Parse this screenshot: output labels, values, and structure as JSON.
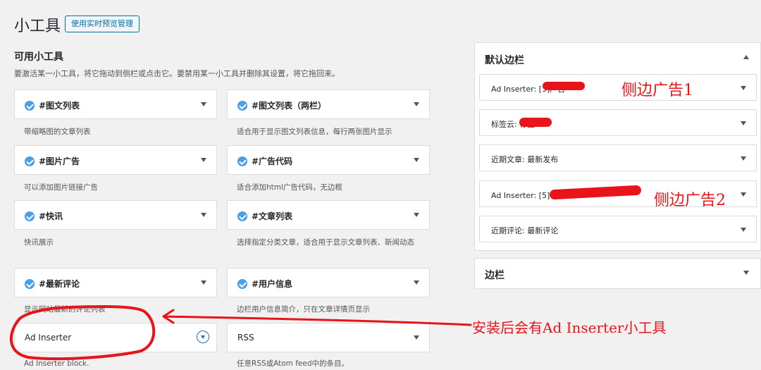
{
  "header": {
    "title": "小工具",
    "button_label": "使用实时预览管理"
  },
  "available": {
    "heading": "可用小工具",
    "description": "要激活某一小工具，将它拖动到侧栏或点击它。要禁用某一小工具并删除其设置，将它拖回来。",
    "widgets": [
      {
        "title": "#图文列表",
        "desc": "带缩略图的文章列表"
      },
      {
        "title": "#图文列表（两栏）",
        "desc": "适合用于显示图文列表信息，每行两张图片显示"
      },
      {
        "title": "#图片广告",
        "desc": "可以添加图片链接广告"
      },
      {
        "title": "#广告代码",
        "desc": "适合添加html广告代码，无边框"
      },
      {
        "title": "#快讯",
        "desc": "快讯展示"
      },
      {
        "title": "#文章列表",
        "desc": "选择指定分类文章，适合用于显示文章列表、新闻动态"
      },
      {
        "title": "#最新评论",
        "desc": "显示网站最新的评论列表"
      },
      {
        "title": "#用户信息",
        "desc": "边栏用户信息简介，只在文章详情页显示"
      },
      {
        "title": "Ad Inserter",
        "desc": "Ad Inserter block."
      },
      {
        "title": "RSS",
        "desc": "任意RSS或Atom feed中的条目。"
      }
    ]
  },
  "sidebars": {
    "default": {
      "title": "默认边栏",
      "widgets": [
        {
          "label": "Ad Inserter: [3]广告"
        },
        {
          "label": "标签云: 标签"
        },
        {
          "label": "近期文章: 最新发布"
        },
        {
          "label": "Ad Inserter: [5]右侧"
        },
        {
          "label": "近期评论: 最新评论"
        }
      ]
    },
    "second": {
      "title": "边栏"
    }
  },
  "annotations": {
    "side_ad_1": "侧边广告1",
    "side_ad_2": "侧边广告2",
    "install_note": "安装后会有Ad Inserter小工具",
    "color": "#e8141a"
  },
  "colors": {
    "accent": "#0071a1",
    "icon_blue": "#4a9fe8",
    "background": "#f1f1f1"
  }
}
